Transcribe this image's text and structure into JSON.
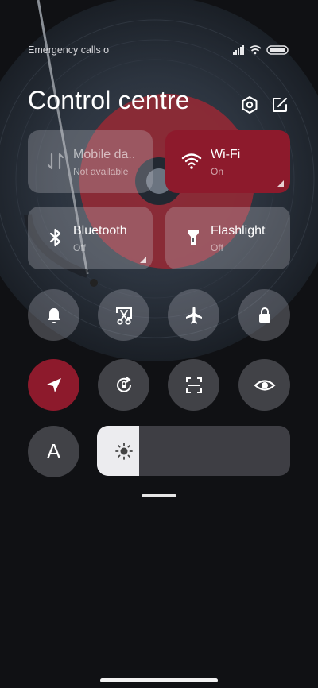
{
  "status_bar": {
    "carrier_text": "Emergency calls o",
    "signal_icon": "signal-icon",
    "wifi_icon": "wifi-icon",
    "battery_icon": "battery-icon"
  },
  "header": {
    "title": "Control centre",
    "settings_icon": "gear-icon",
    "edit_icon": "edit-icon"
  },
  "tiles": [
    {
      "name": "Mobile da..",
      "status": "Not available",
      "icon": "mobile-data-icon",
      "active": false
    },
    {
      "name": "Wi-Fi",
      "status": "On",
      "icon": "wifi-icon",
      "active": true
    },
    {
      "name": "Bluetooth",
      "status": "Off",
      "icon": "bluetooth-icon",
      "active": false
    },
    {
      "name": "Flashlight",
      "status": "Off",
      "icon": "flashlight-icon",
      "active": false
    }
  ],
  "toggles_row1": [
    {
      "icon": "bell-icon",
      "active": false
    },
    {
      "icon": "screenshot-icon",
      "active": false
    },
    {
      "icon": "airplane-icon",
      "active": false
    },
    {
      "icon": "lock-icon",
      "active": false
    }
  ],
  "toggles_row2": [
    {
      "icon": "location-icon",
      "active": true
    },
    {
      "icon": "rotation-lock-icon",
      "active": false
    },
    {
      "icon": "scan-icon",
      "active": false
    },
    {
      "icon": "eye-icon",
      "active": false
    }
  ],
  "font_button": {
    "label": "A"
  },
  "brightness": {
    "level": 0.22,
    "icon": "sun-icon"
  },
  "colors": {
    "accent": "#8d1a2c",
    "tile": "#5a5b62",
    "background": "#101114"
  }
}
